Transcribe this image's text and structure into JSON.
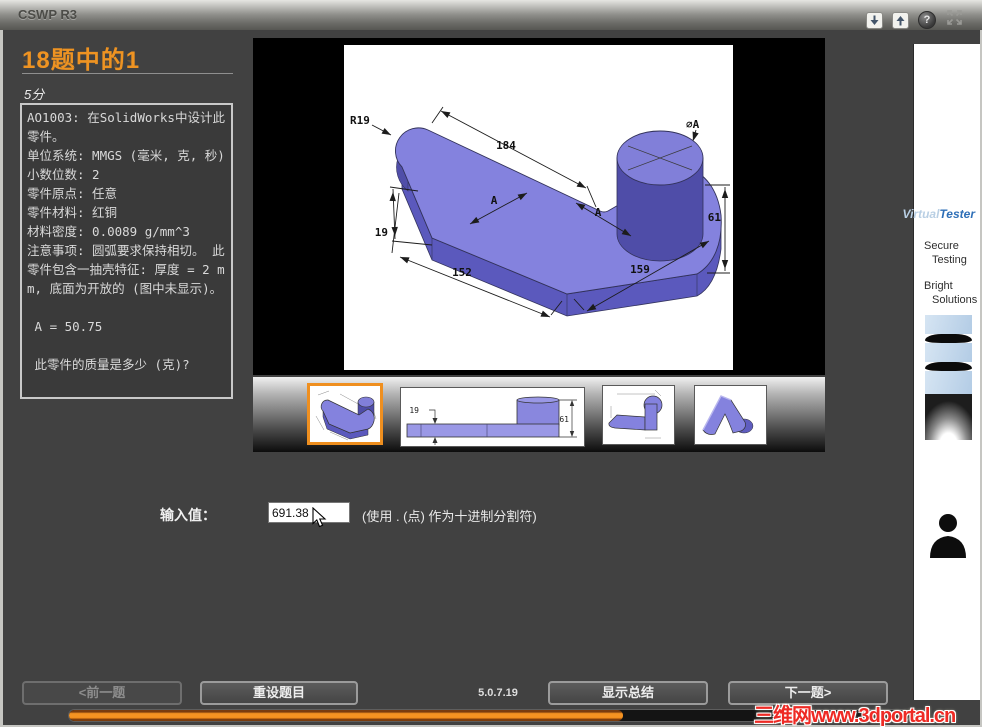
{
  "titlebar": {
    "title": "CSWP R3",
    "help_glyph": "?",
    "icons": [
      "arrow-down-icon",
      "arrow-up-icon",
      "help-icon",
      "fullscreen-icon"
    ]
  },
  "header": {
    "question_counter": "18题中的1",
    "points": "5分"
  },
  "question_text": "AO1003: 在SolidWorks中设计此零件。\n单位系统: MMGS (毫米, 克, 秒)\n小数位数: 2\n零件原点: 任意\n零件材料: 红铜\n材料密度: 0.0089 g/mm^3\n注意事项: 圆弧要求保持相切。 此零件包含一抽壳特征: 厚度 = 2 mm, 底面为开放的 (图中未显示)。\n\n A = 50.75\n\n 此零件的质量是多少 (克)?",
  "figure": {
    "dims": {
      "radius": "R19",
      "top_length": "184",
      "diameter": "⌀A",
      "height": "61",
      "a1": "A",
      "a2": "A",
      "thickness": "19",
      "left_length": "152",
      "right_length": "159"
    },
    "thumb2": {
      "thickness": "19",
      "height": "61"
    }
  },
  "answer": {
    "label": "输入值：",
    "value": "691.38",
    "hint": "(使用 . (点) 作为十进制分割符)"
  },
  "footer": {
    "prev_label": "<前一题",
    "reset_label": "重设题目",
    "version": "5.0.7.19",
    "summary_label": "显示总结",
    "next_label": "下一题>"
  },
  "progress": {
    "percent": 66
  },
  "sidebar": {
    "brand_light": "Virtual",
    "brand_dark": "Tester",
    "tagline1_a": "Secure",
    "tagline1_b": "Testing",
    "tagline2_a": "Bright",
    "tagline2_b": "Solutions"
  },
  "watermark": "三维网www.3dportal.cn",
  "colors": {
    "accent_orange": "#ee9322",
    "progress_orange": "#f18c1a",
    "part_purple_top": "#8482de",
    "part_purple_side": "#5b59bd",
    "brand_blue": "#2e6fb7",
    "watermark_red": "#ee2a24"
  }
}
